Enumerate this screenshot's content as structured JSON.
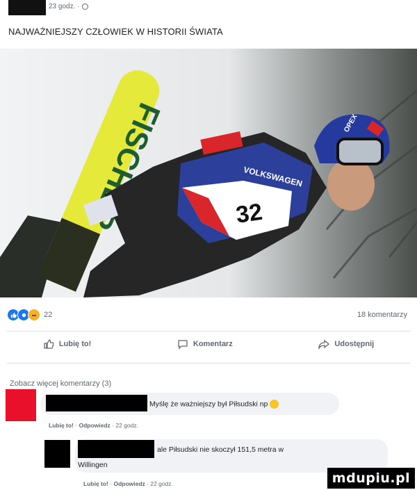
{
  "header": {
    "timestamp": "23 godz. ·",
    "privacy_icon": "globe-icon",
    "post_text": "NAJWAŻNIEJSZY CZŁOWIEK W HISTORII ŚWIATA"
  },
  "photo": {
    "ski_text": "FISCHER",
    "bib_number": "32",
    "sponsor": "VOLKSWAGEN",
    "helmet_text": "OPEX"
  },
  "stats": {
    "reaction_icons": [
      "like-icon",
      "love-icon",
      "haha-icon"
    ],
    "reaction_count": "22",
    "comment_count": "18 komentarzy"
  },
  "actions": {
    "like": "Lubię to!",
    "comment": "Komentarz",
    "share": "Udostępnij"
  },
  "comments": {
    "more_link": "Zobacz więcej komentarzy (3)",
    "items": [
      {
        "text": "Myślę że ważniejszy był Piłsudski np",
        "meta_like": "Lubię to!",
        "meta_reply": "Odpowiedz",
        "meta_time": "22 godz."
      },
      {
        "text_line1": "ale Piłsudski nie skoczył 151,5 metra w",
        "text_line2": "Willingen",
        "meta_like": "Lubię to!",
        "meta_reply": "Odpowiedz",
        "meta_time": "22 godz."
      }
    ]
  },
  "watermark": "mdupiu.pl",
  "colors": {
    "brand_blue": "#1877f2",
    "meta_gray": "#606770",
    "avatar_red": "#e8102a"
  }
}
